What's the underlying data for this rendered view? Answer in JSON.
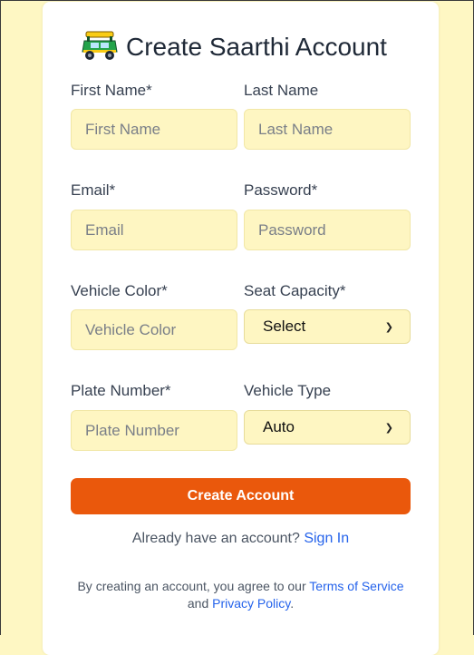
{
  "title": "Create Saarthi Account",
  "title_icon": "auto-rickshaw-icon",
  "fields": {
    "first_name": {
      "label": "First Name*",
      "placeholder": "First Name"
    },
    "last_name": {
      "label": "Last Name",
      "placeholder": "Last Name"
    },
    "email": {
      "label": "Email*",
      "placeholder": "Email"
    },
    "password": {
      "label": "Password*",
      "placeholder": "Password"
    },
    "vehicle_color": {
      "label": "Vehicle Color*",
      "placeholder": "Vehicle Color"
    },
    "seat_capacity": {
      "label": "Seat Capacity*",
      "value": "Select"
    },
    "plate_number": {
      "label": "Plate Number*",
      "placeholder": "Plate Number"
    },
    "vehicle_type": {
      "label": "Vehicle Type",
      "value": "Auto"
    }
  },
  "submit_label": "Create Account",
  "signin": {
    "prompt": "Already have an account?",
    "link": "Sign In"
  },
  "terms": {
    "prefix": "By creating an account, you agree to our",
    "tos": "Terms of Service",
    "and": "and",
    "privacy": "Privacy Policy",
    "suffix": "."
  },
  "colors": {
    "background": "#fef7c3",
    "input_bg": "#fef6c2",
    "primary": "#ea580c",
    "link": "#2563eb"
  }
}
